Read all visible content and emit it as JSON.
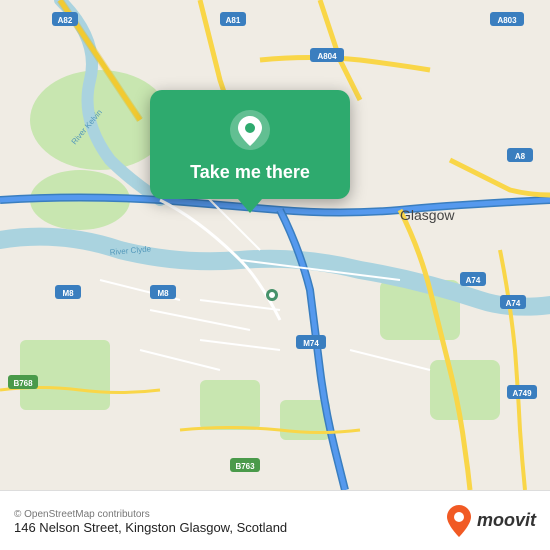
{
  "map": {
    "attribution": "© OpenStreetMap contributors",
    "center_label": "146 Nelson Street, Kingston Glasgow, Scotland",
    "popup": {
      "cta": "Take me there"
    }
  },
  "branding": {
    "logo_text": "moovit"
  },
  "roads": [
    {
      "id": "A82",
      "label": "A82"
    },
    {
      "id": "A81",
      "label": "A81"
    },
    {
      "id": "A803",
      "label": "A803"
    },
    {
      "id": "A804",
      "label": "A804"
    },
    {
      "id": "M8",
      "label": "M8"
    },
    {
      "id": "A8",
      "label": "A8"
    },
    {
      "id": "M74",
      "label": "M74"
    },
    {
      "id": "A74",
      "label": "A74"
    },
    {
      "id": "A749",
      "label": "A749"
    },
    {
      "id": "B768",
      "label": "B768"
    },
    {
      "id": "B763",
      "label": "B763"
    },
    {
      "id": "Glasgow",
      "label": "Glasgow"
    }
  ]
}
